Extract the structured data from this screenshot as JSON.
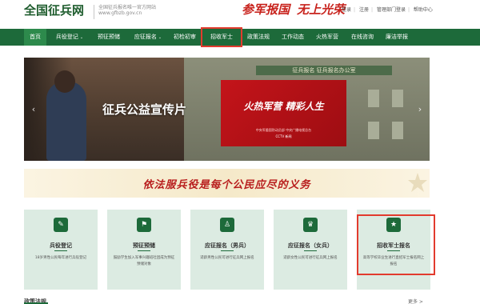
{
  "header": {
    "site_title": "全国征兵网",
    "sub_line1": "全国征兵报名唯一官方网站",
    "sub_line2": "www.gfbzb.gov.cn",
    "slogan_part1": "参军报国",
    "slogan_part2": "无上光荣",
    "links": [
      "登录",
      "注册",
      "管理部门登录",
      "帮助中心"
    ],
    "link_separator": "|"
  },
  "nav": {
    "items": [
      {
        "label": "首页",
        "dropdown": false
      },
      {
        "label": "兵役登记",
        "dropdown": true
      },
      {
        "label": "预征预储",
        "dropdown": false
      },
      {
        "label": "应征报名",
        "dropdown": true
      },
      {
        "label": "初检初审",
        "dropdown": false
      },
      {
        "label": "招收军士",
        "dropdown": false
      },
      {
        "label": "政策法规",
        "dropdown": false
      },
      {
        "label": "工作动态",
        "dropdown": false
      },
      {
        "label": "火热军营",
        "dropdown": false
      },
      {
        "label": "在线咨询",
        "dropdown": false
      },
      {
        "label": "廉洁举报",
        "dropdown": false
      }
    ],
    "caret_symbol": "⌄",
    "active_color": "#2d8a4c",
    "bar_color": "#1d6a3a",
    "highlight_color": "#e23b2e"
  },
  "banner": {
    "title": "征兵公益宣传片",
    "red_title": "火热军营 精彩人生",
    "red_small": "中央军委国防动员部 中央广播电视总台",
    "red_cctv": "CCTV 新闻",
    "sign_text": "征兵报名 征兵报名办公室",
    "prev_icon": "‹",
    "next_icon": "›"
  },
  "motto": {
    "text": "依法服兵役是每个公民应尽的义务"
  },
  "cards": [
    {
      "title": "兵役登记",
      "desc": "18岁男性公民每年进行兵役登记",
      "icon": "✎"
    },
    {
      "title": "预征预储",
      "desc": "鼓励学生加入军事兴趣班社团成为预征预储对象",
      "icon": "⚑"
    },
    {
      "title": "应征报名（男兵）",
      "desc": "适龄男性公民可进行征兵网上报名",
      "icon": "♙"
    },
    {
      "title": "应征报名（女兵）",
      "desc": "适龄女性公民可进行征兵网上报名",
      "icon": "♛"
    },
    {
      "title": "招收军士报名",
      "desc": "高等学校毕业生进行直招军士报名网上报名",
      "icon": "★"
    }
  ],
  "bottom": {
    "section_title": "政策法规",
    "more": "更多 >"
  }
}
